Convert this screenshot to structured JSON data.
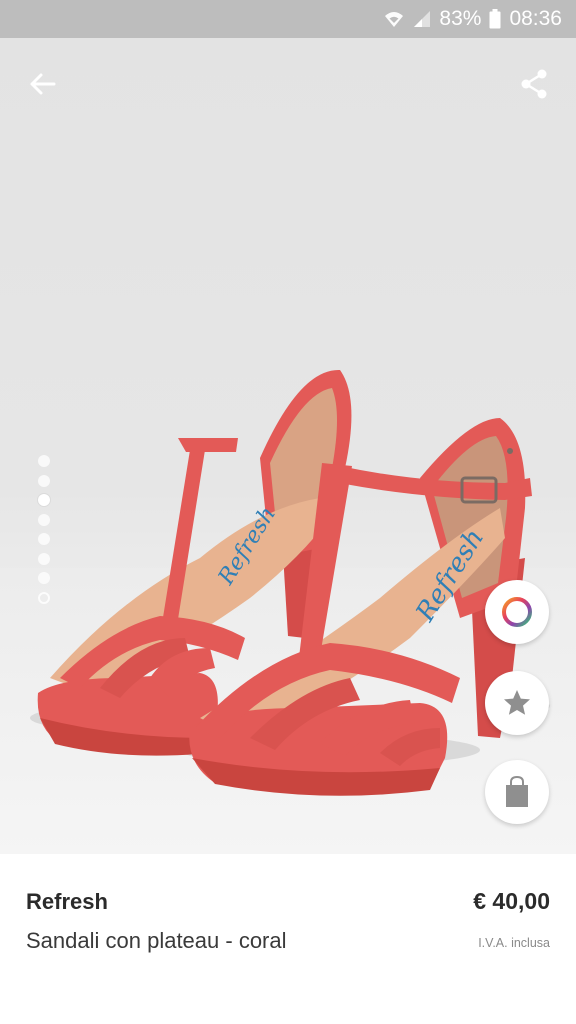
{
  "status_bar": {
    "battery": "83%",
    "time": "08:36",
    "icons": [
      "wifi-icon",
      "signal-icon",
      "battery-icon"
    ]
  },
  "toolbar": {
    "back_icon": "arrow-left-icon",
    "share_icon": "share-icon"
  },
  "gallery": {
    "image_subject": "coral t-bar platform sandals",
    "pages": 8,
    "current_page": 3
  },
  "actions": [
    {
      "name": "color-options-button",
      "icon": "color-ring-icon"
    },
    {
      "name": "favorite-button",
      "icon": "star-icon"
    },
    {
      "name": "add-to-bag-button",
      "icon": "shopping-bag-icon"
    }
  ],
  "product": {
    "brand": "Refresh",
    "name": "Sandali con plateau - coral",
    "price": "€ 40,00",
    "vat_note": "I.V.A. inclusa",
    "insole_brand": "Refresh"
  },
  "colors": {
    "status_bar": "#bdbdbd",
    "coral": "#e35a57",
    "text_primary": "#2b2b2b",
    "text_muted": "#8a8a8a"
  }
}
